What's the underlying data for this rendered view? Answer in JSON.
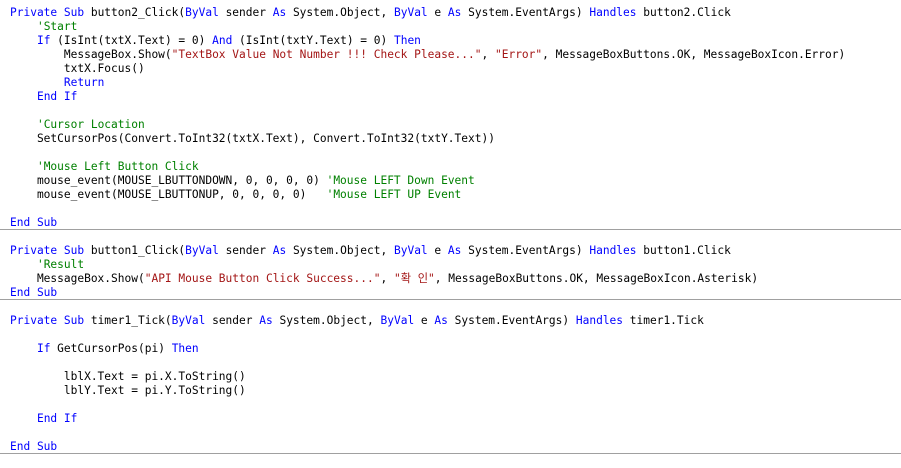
{
  "colors": {
    "keyword": "#0000ff",
    "string": "#a31515",
    "comment": "#008000",
    "text": "#000000",
    "separator": "#a0a0a0"
  },
  "lines": [
    {
      "sep": false,
      "tokens": [
        [
          "kw",
          "Private Sub"
        ],
        [
          "tx",
          " button2_Click("
        ],
        [
          "kw",
          "ByVal"
        ],
        [
          "tx",
          " sender "
        ],
        [
          "kw",
          "As"
        ],
        [
          "tx",
          " System.Object, "
        ],
        [
          "kw",
          "ByVal"
        ],
        [
          "tx",
          " e "
        ],
        [
          "kw",
          "As"
        ],
        [
          "tx",
          " System.EventArgs) "
        ],
        [
          "kw",
          "Handles"
        ],
        [
          "tx",
          " button2.Click"
        ]
      ]
    },
    {
      "sep": false,
      "tokens": [
        [
          "tx",
          "    "
        ],
        [
          "cm",
          "'Start"
        ]
      ]
    },
    {
      "sep": false,
      "tokens": [
        [
          "tx",
          "    "
        ],
        [
          "kw",
          "If"
        ],
        [
          "tx",
          " (IsInt(txtX.Text) = 0) "
        ],
        [
          "kw",
          "And"
        ],
        [
          "tx",
          " (IsInt(txtY.Text) = 0) "
        ],
        [
          "kw",
          "Then"
        ]
      ]
    },
    {
      "sep": false,
      "tokens": [
        [
          "tx",
          "        MessageBox.Show("
        ],
        [
          "str",
          "\"TextBox Value Not Number !!! Check Please...\""
        ],
        [
          "tx",
          ", "
        ],
        [
          "str",
          "\"Error\""
        ],
        [
          "tx",
          ", MessageBoxButtons.OK, MessageBoxIcon.Error)"
        ]
      ]
    },
    {
      "sep": false,
      "tokens": [
        [
          "tx",
          "        txtX.Focus()"
        ]
      ]
    },
    {
      "sep": false,
      "tokens": [
        [
          "tx",
          "        "
        ],
        [
          "kw",
          "Return"
        ]
      ]
    },
    {
      "sep": false,
      "tokens": [
        [
          "tx",
          "    "
        ],
        [
          "kw",
          "End If"
        ]
      ]
    },
    {
      "sep": false,
      "tokens": []
    },
    {
      "sep": false,
      "tokens": [
        [
          "tx",
          "    "
        ],
        [
          "cm",
          "'Cursor Location"
        ]
      ]
    },
    {
      "sep": false,
      "tokens": [
        [
          "tx",
          "    SetCursorPos(Convert.ToInt32(txtX.Text), Convert.ToInt32(txtY.Text))"
        ]
      ]
    },
    {
      "sep": false,
      "tokens": []
    },
    {
      "sep": false,
      "tokens": [
        [
          "tx",
          "    "
        ],
        [
          "cm",
          "'Mouse Left Button Click"
        ]
      ]
    },
    {
      "sep": false,
      "tokens": [
        [
          "tx",
          "    mouse_event(MOUSE_LBUTTONDOWN, 0, 0, 0, 0) "
        ],
        [
          "cm",
          "'Mouse LEFT Down Event"
        ]
      ]
    },
    {
      "sep": false,
      "tokens": [
        [
          "tx",
          "    mouse_event(MOUSE_LBUTTONUP, 0, 0, 0, 0)   "
        ],
        [
          "cm",
          "'Mouse LEFT UP Event"
        ]
      ]
    },
    {
      "sep": false,
      "tokens": []
    },
    {
      "sep": true,
      "tokens": [
        [
          "kw",
          "End Sub"
        ]
      ]
    },
    {
      "sep": false,
      "tokens": []
    },
    {
      "sep": false,
      "tokens": [
        [
          "kw",
          "Private Sub"
        ],
        [
          "tx",
          " button1_Click("
        ],
        [
          "kw",
          "ByVal"
        ],
        [
          "tx",
          " sender "
        ],
        [
          "kw",
          "As"
        ],
        [
          "tx",
          " System.Object, "
        ],
        [
          "kw",
          "ByVal"
        ],
        [
          "tx",
          " e "
        ],
        [
          "kw",
          "As"
        ],
        [
          "tx",
          " System.EventArgs) "
        ],
        [
          "kw",
          "Handles"
        ],
        [
          "tx",
          " button1.Click"
        ]
      ]
    },
    {
      "sep": false,
      "tokens": [
        [
          "tx",
          "    "
        ],
        [
          "cm",
          "'Result"
        ]
      ]
    },
    {
      "sep": false,
      "tokens": [
        [
          "tx",
          "    MessageBox.Show("
        ],
        [
          "str",
          "\"API Mouse Button Click Success...\""
        ],
        [
          "tx",
          ", "
        ],
        [
          "str",
          "\"확 인\""
        ],
        [
          "tx",
          ", MessageBoxButtons.OK, MessageBoxIcon.Asterisk)"
        ]
      ]
    },
    {
      "sep": true,
      "tokens": [
        [
          "kw",
          "End Sub"
        ]
      ]
    },
    {
      "sep": false,
      "tokens": []
    },
    {
      "sep": false,
      "tokens": [
        [
          "kw",
          "Private Sub"
        ],
        [
          "tx",
          " timer1_Tick("
        ],
        [
          "kw",
          "ByVal"
        ],
        [
          "tx",
          " sender "
        ],
        [
          "kw",
          "As"
        ],
        [
          "tx",
          " System.Object, "
        ],
        [
          "kw",
          "ByVal"
        ],
        [
          "tx",
          " e "
        ],
        [
          "kw",
          "As"
        ],
        [
          "tx",
          " System.EventArgs) "
        ],
        [
          "kw",
          "Handles"
        ],
        [
          "tx",
          " timer1.Tick"
        ]
      ]
    },
    {
      "sep": false,
      "tokens": []
    },
    {
      "sep": false,
      "tokens": [
        [
          "tx",
          "    "
        ],
        [
          "kw",
          "If"
        ],
        [
          "tx",
          " GetCursorPos(pi) "
        ],
        [
          "kw",
          "Then"
        ]
      ]
    },
    {
      "sep": false,
      "tokens": []
    },
    {
      "sep": false,
      "tokens": [
        [
          "tx",
          "        lblX.Text = pi.X.ToString()"
        ]
      ]
    },
    {
      "sep": false,
      "tokens": [
        [
          "tx",
          "        lblY.Text = pi.Y.ToString()"
        ]
      ]
    },
    {
      "sep": false,
      "tokens": []
    },
    {
      "sep": false,
      "tokens": [
        [
          "tx",
          "    "
        ],
        [
          "kw",
          "End If"
        ]
      ]
    },
    {
      "sep": false,
      "tokens": []
    },
    {
      "sep": true,
      "tokens": [
        [
          "kw",
          "End Sub"
        ]
      ]
    }
  ]
}
